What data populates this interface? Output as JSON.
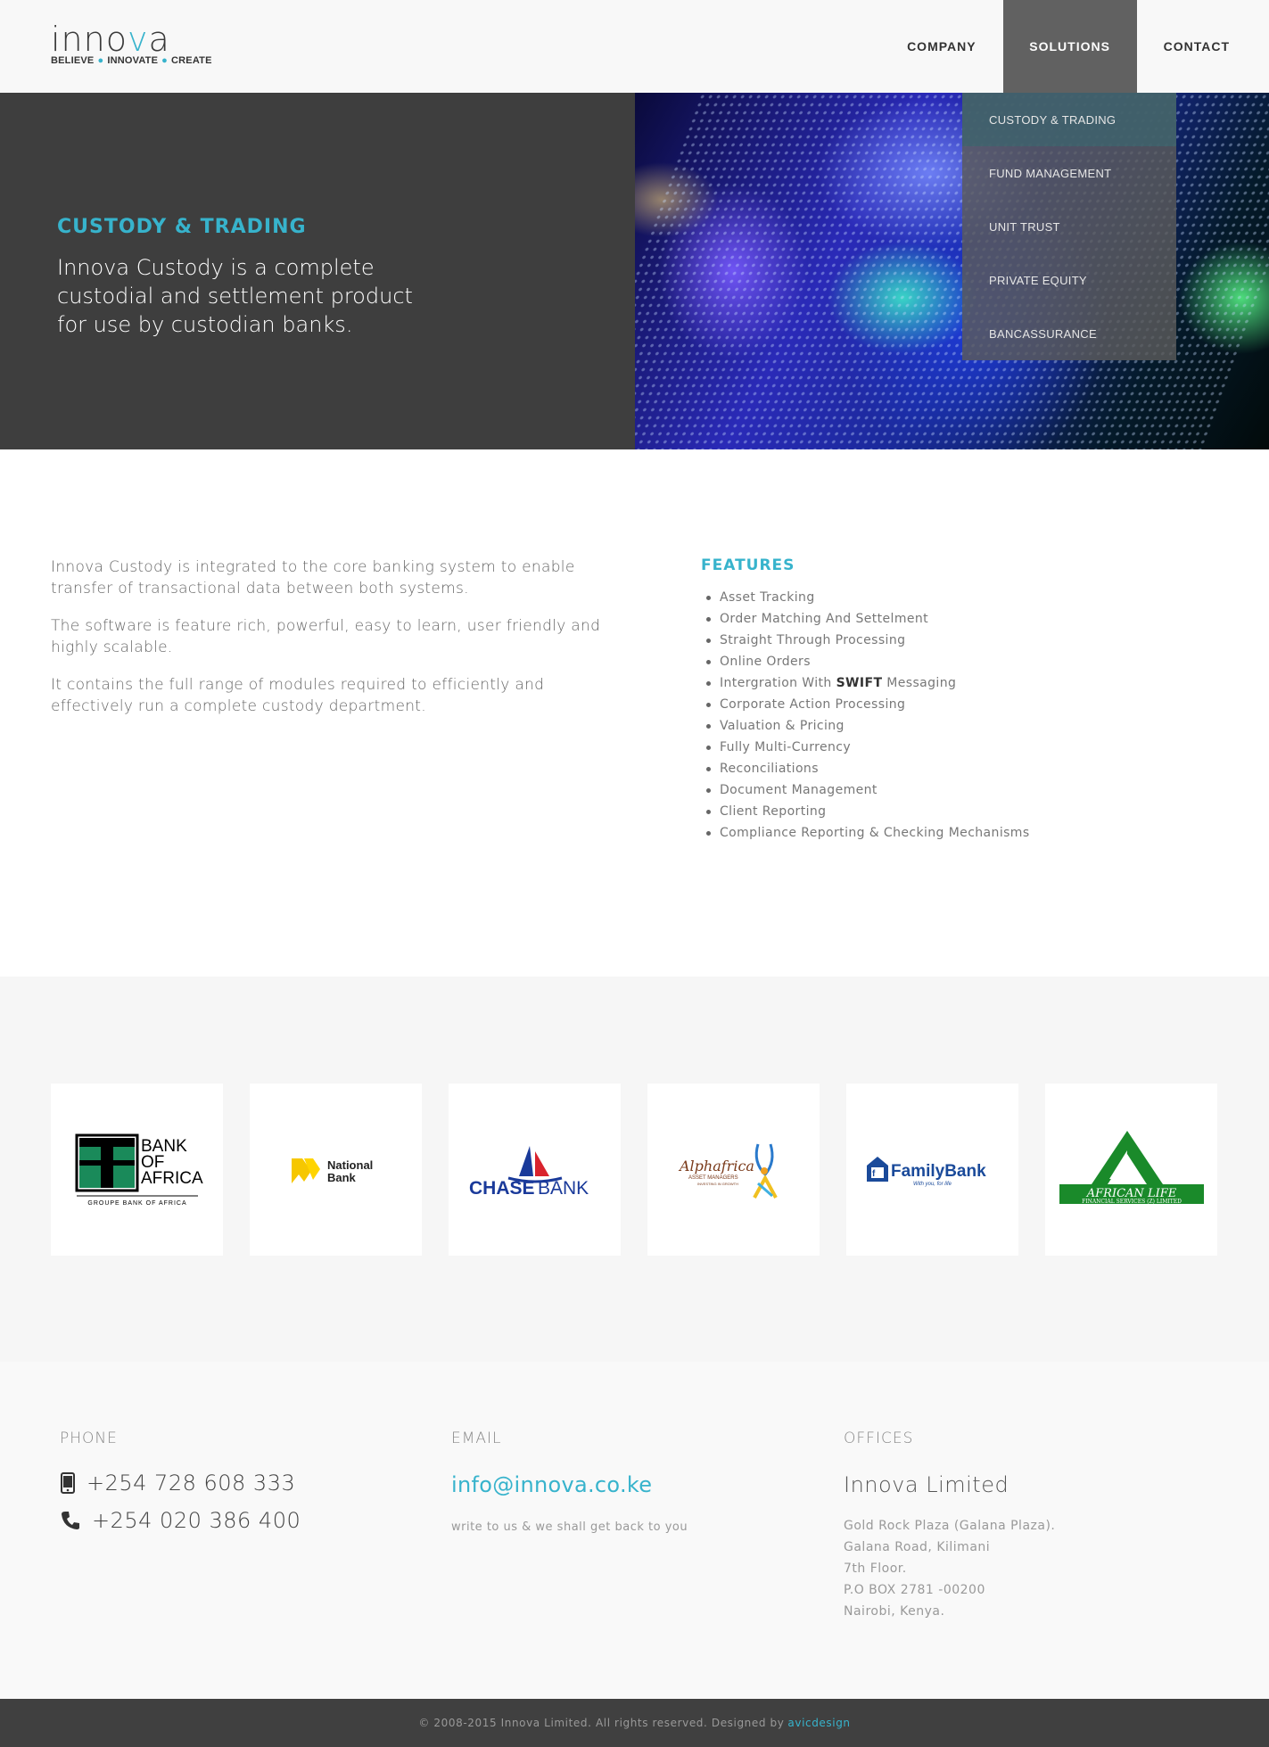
{
  "brand": {
    "name_pre": "inno",
    "name_acc": "v",
    "name_post": "a",
    "tag1": "BELIEVE",
    "tag2": "INNOVATE",
    "tag3": "CREATE"
  },
  "nav": {
    "company": "COMPANY",
    "solutions": "SOLUTIONS",
    "contact": "CONTACT"
  },
  "dropdown": {
    "items": [
      "CUSTODY & TRADING",
      "FUND MANAGEMENT",
      "UNIT TRUST",
      "PRIVATE EQUITY",
      "BANCASSURANCE"
    ]
  },
  "hero": {
    "kicker": "CUSTODY & TRADING",
    "text": "Innova Custody is a complete custodial and settlement product for use by custodian banks."
  },
  "intro": {
    "p1": "Innova Custody is integrated to the core banking system to enable transfer of transactional data between both systems.",
    "p2": "The software is feature rich, powerful, easy to learn, user friendly and highly scalable.",
    "p3": "It contains the full range of modules required to efficiently and effectively run a complete custody department."
  },
  "features": {
    "title": "FEATURES",
    "items": [
      "Asset Tracking",
      "Order Matching And Settelment",
      "Straight Through Processing",
      "Online Orders",
      "Intergration With",
      "Corporate Action Processing",
      "Valuation & Pricing",
      "Fully Multi-Currency",
      "Reconciliations",
      "Document Management",
      "Client Reporting",
      "Compliance Reporting & Checking Mechanisms"
    ],
    "swift_bold": "SWIFT",
    "swift_tail": " Messaging"
  },
  "clients": {
    "boa": {
      "l1": "BANK",
      "l2": "OF",
      "l3": "AFRICA",
      "sub": "GROUPE BANK OF AFRICA"
    },
    "national": {
      "l1": "National",
      "l2": "Bank"
    },
    "chase": {
      "a": "CHASE",
      "b": "BANK"
    },
    "alpha": {
      "a": "Alphafrica",
      "b": "ASSET MANAGERS",
      "c": "INVESTING IN GROWTH"
    },
    "family": {
      "a": "FamilyBank",
      "b": "With you, for life"
    },
    "african": {
      "a": "AFRICAN LIFE",
      "b": "FINANCIAL SERVICES (Z) LIMITED"
    }
  },
  "footer": {
    "phone_label": "PHONE",
    "mobile": "+254 728 608 333",
    "landline": "+254 020 386 400",
    "email_label": "EMAIL",
    "email": "info@innova.co.ke",
    "email_note": "write to us & we shall get back to you",
    "offices_label": "OFFICES",
    "office_name": "Innova Limited",
    "address": [
      "Gold Rock Plaza (Galana Plaza).",
      "Galana Road, Kilimani",
      "7th Floor.",
      "P.O BOX 2781 -00200",
      "Nairobi, Kenya."
    ]
  },
  "copyright": {
    "text": "© 2008-2015 Innova Limited. All rights reserved. Designed by",
    "designer": "avicdesign"
  },
  "colors": {
    "accent": "#37b3cc",
    "dark": "#3e3e3e",
    "nav_active": "#616161"
  }
}
